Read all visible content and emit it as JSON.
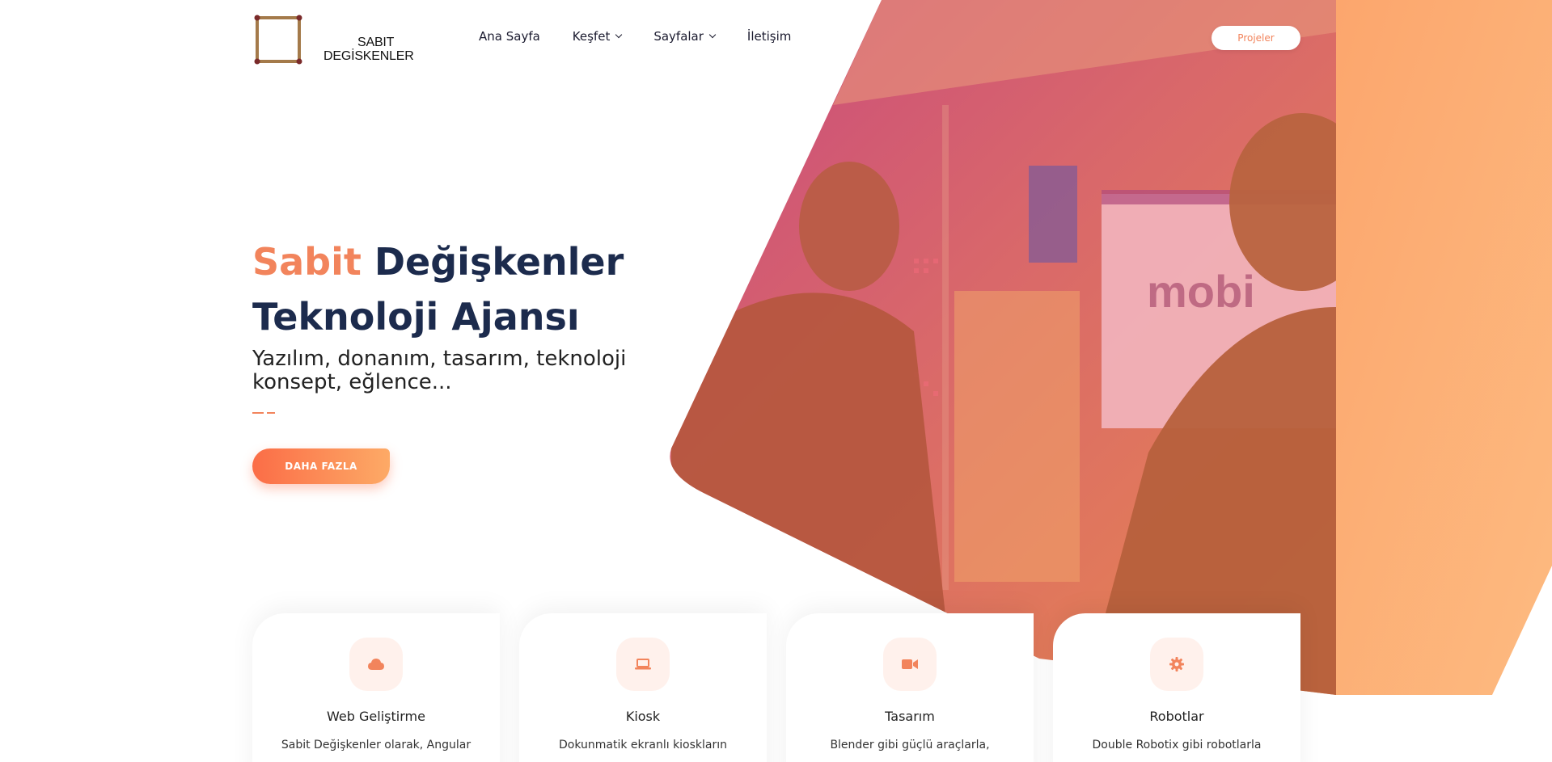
{
  "logo": {
    "line1": "SABIT",
    "line2": "DEGİSKENLER"
  },
  "nav": [
    {
      "label": "Ana Sayfa",
      "dropdown": false
    },
    {
      "label": "Keşfet",
      "dropdown": true
    },
    {
      "label": "Sayfalar",
      "dropdown": true
    },
    {
      "label": "İletişim",
      "dropdown": false
    }
  ],
  "header": {
    "projects_label": "Projeler"
  },
  "hero": {
    "title_accent": "Sabit",
    "title_rest": "Değişkenler",
    "title_line2": "Teknoloji Ajansı",
    "subtitle": "Yazılım, donanım, tasarım, teknoloji konsept, eğlence...",
    "button_label": "DAHA FAZLA"
  },
  "colors": {
    "accent": "#f2845c",
    "navy": "#1c2b4d",
    "icon_bg": "#fff1ec"
  },
  "services": [
    {
      "title": "Web Geliştirme",
      "desc": "Sabit Değişkenler olarak, Angular",
      "icon": "cloud-icon"
    },
    {
      "title": "Kiosk",
      "desc": "Dokunmatik ekranlı kioskların",
      "icon": "laptop-icon"
    },
    {
      "title": "Tasarım",
      "desc": "Blender gibi güçlü araçlarla,",
      "icon": "video-camera-icon"
    },
    {
      "title": "Robotlar",
      "desc": "Double Robotix gibi robotlarla",
      "icon": "gear-icon"
    }
  ]
}
